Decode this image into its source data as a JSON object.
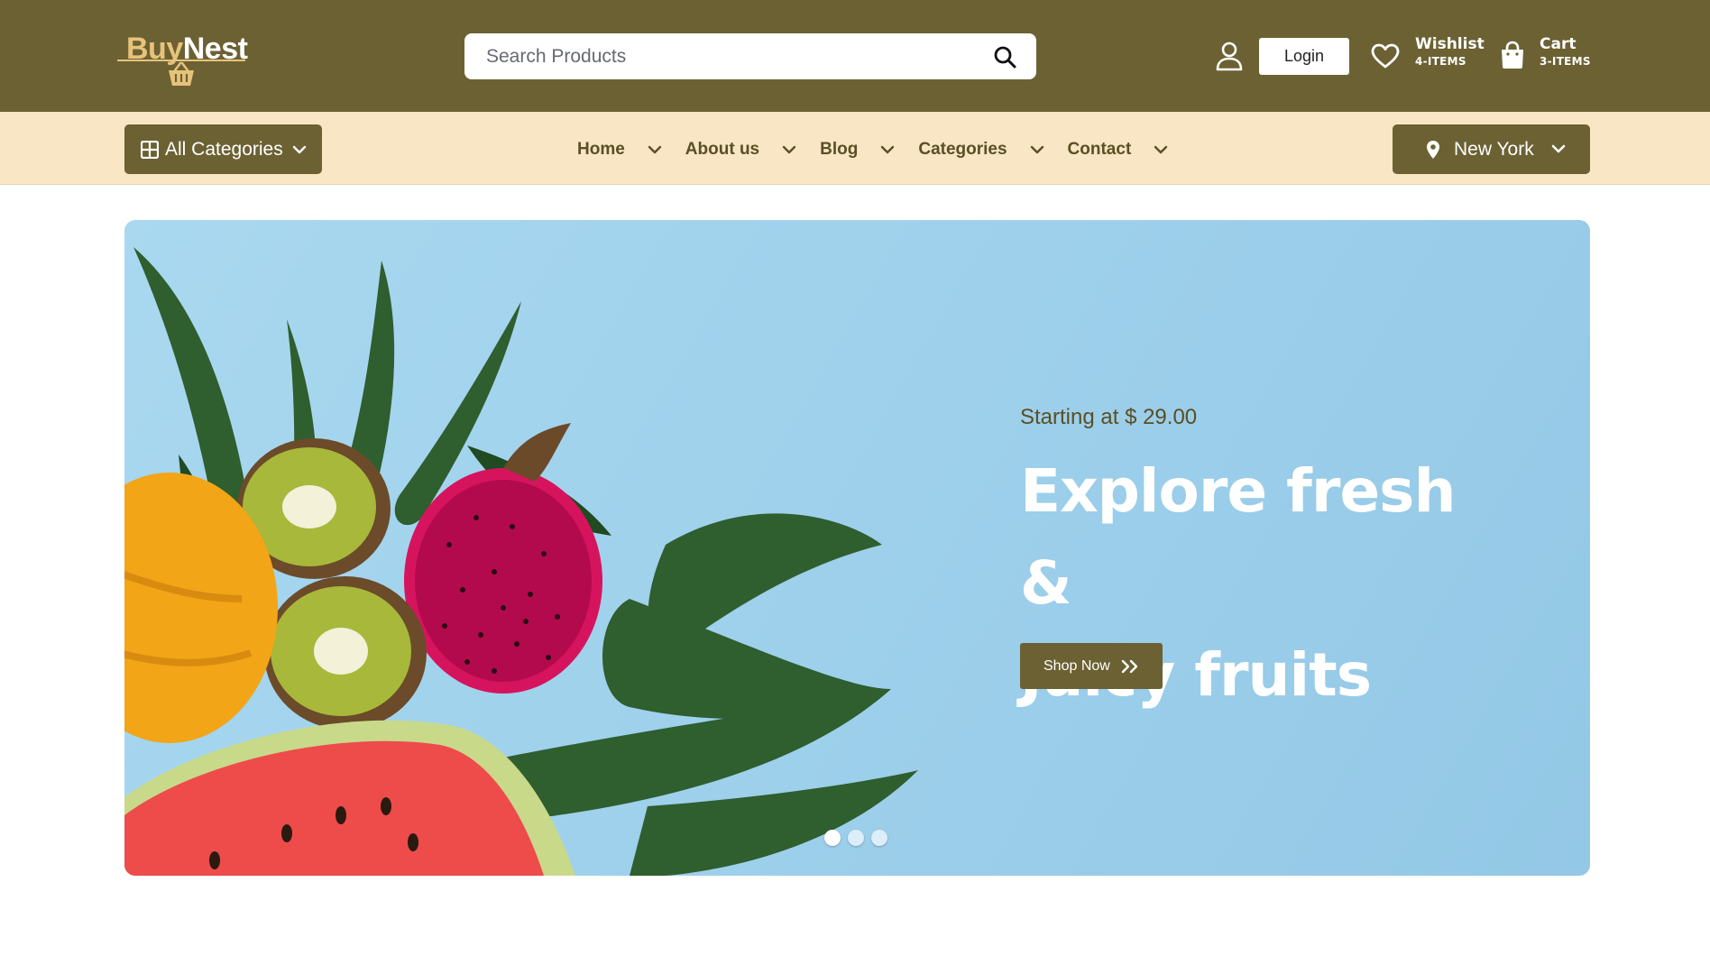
{
  "header": {
    "logo": {
      "part1": "Buy",
      "part2": "Nest"
    },
    "search": {
      "placeholder": "Search Products",
      "value": ""
    },
    "login_label": "Login",
    "wishlist": {
      "label": "Wishlist",
      "count": "4-ITEMS"
    },
    "cart": {
      "label": "Cart",
      "count": "3-ITEMS"
    }
  },
  "nav": {
    "all_categories": "All Categories",
    "items": [
      {
        "label": "Home"
      },
      {
        "label": "About us"
      },
      {
        "label": "Blog"
      },
      {
        "label": "Categories"
      },
      {
        "label": "Contact"
      }
    ],
    "location": "New York"
  },
  "hero": {
    "subtitle": "Starting at $ 29.00",
    "title_line1": "Explore fresh &",
    "title_line2": "Juicy fruits",
    "cta": "Shop Now",
    "slides": 3,
    "active_slide": 1
  },
  "colors": {
    "brand": "#6c6133",
    "nav_bg": "#f8e6c4",
    "accent_gold": "#e6c37a",
    "hero_bg": "#a9d8ef"
  }
}
